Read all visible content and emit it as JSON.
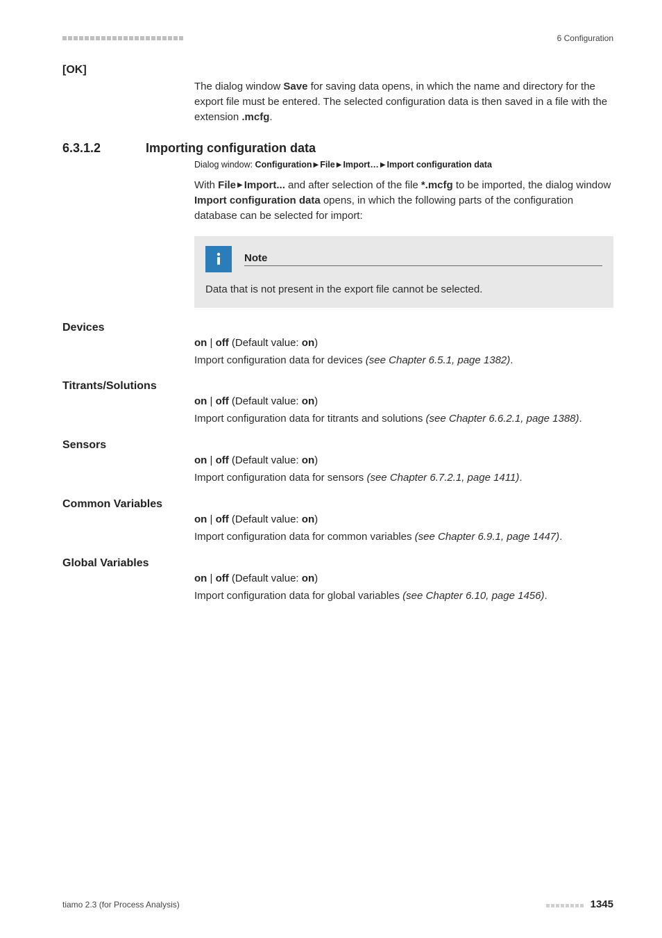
{
  "header": {
    "chapter": "6 Configuration"
  },
  "ok": {
    "label": "[OK]",
    "body_prefix": "The dialog window ",
    "body_bold1": "Save",
    "body_mid": " for saving data opens, in which the name and directory for the export file must be entered. The selected configuration data is then saved in a file with the extension ",
    "body_bold2": ".mcfg",
    "body_suffix": "."
  },
  "section": {
    "number": "6.3.1.2",
    "title": "Importing configuration data",
    "dialog_prefix": "Dialog window: ",
    "dialog_b1": "Configuration",
    "dialog_b2": "File",
    "dialog_b3": "Import…",
    "dialog_b4": "Import configuration data",
    "para_pre": "With ",
    "para_b_file": "File",
    "para_b_import": "Import...",
    "para_mid1": " and after selection of the file ",
    "para_b_mcfg": "*.mcfg",
    "para_mid2": " to be imported, the dialog window ",
    "para_b_icd": "Import configuration data",
    "para_suffix": " opens, in which the following parts of the configuration database can be selected for import:"
  },
  "note": {
    "title": "Note",
    "body": "Data that is not present in the export file cannot be selected."
  },
  "defs": {
    "on": "on",
    "off": "off",
    "default_label": " (Default value: ",
    "close_paren": ")",
    "pipe": " | "
  },
  "devices": {
    "label": "Devices",
    "desc_pre": "Import configuration data for devices ",
    "desc_it": "(see Chapter 6.5.1, page 1382)",
    "desc_post": "."
  },
  "titrants": {
    "label": "Titrants/Solutions",
    "desc_pre": "Import configuration data for titrants and solutions ",
    "desc_it": "(see Chapter 6.6.2.1, page 1388)",
    "desc_post": "."
  },
  "sensors": {
    "label": "Sensors",
    "desc_pre": "Import configuration data for sensors ",
    "desc_it": "(see Chapter 6.7.2.1, page 1411)",
    "desc_post": "."
  },
  "common": {
    "label": "Common Variables",
    "desc_pre": "Import configuration data for common variables ",
    "desc_it": "(see Chapter 6.9.1, page 1447)",
    "desc_post": "."
  },
  "global": {
    "label": "Global Variables",
    "desc_pre": "Import configuration data for global variables ",
    "desc_it": "(see Chapter 6.10, page 1456)",
    "desc_post": "."
  },
  "footer": {
    "left": "tiamo 2.3 (for Process Analysis)",
    "page": "1345"
  }
}
